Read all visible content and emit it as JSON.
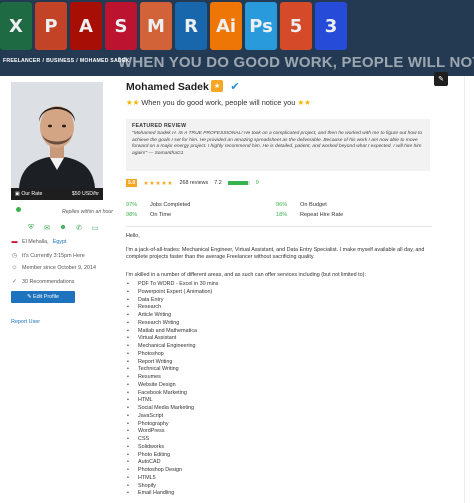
{
  "banner": {
    "icons": [
      {
        "name": "excel-icon",
        "glyph": "X",
        "color": "#1d6f42"
      },
      {
        "name": "powerpoint-icon",
        "glyph": "P",
        "color": "#d04423"
      },
      {
        "name": "acrobat-icon",
        "glyph": "A",
        "color": "#b30b00"
      },
      {
        "name": "solidworks-icon",
        "glyph": "S",
        "color": "#c8102e"
      },
      {
        "name": "matlab-icon",
        "glyph": "M",
        "color": "#e16737"
      },
      {
        "name": "revit-icon",
        "glyph": "R",
        "color": "#186bb4"
      },
      {
        "name": "illustrator-icon",
        "glyph": "Ai",
        "color": "#ff7c00"
      },
      {
        "name": "photoshop-icon",
        "glyph": "Ps",
        "color": "#2aa3e8"
      },
      {
        "name": "html5-icon",
        "glyph": "5",
        "color": "#e44d26"
      },
      {
        "name": "css3-icon",
        "glyph": "3",
        "color": "#264de4"
      }
    ],
    "slogan": "WHEN YOU DO GOOD WORK, PEOPLE WILL NOTICE YOU",
    "breadcrumbs": [
      "FREELANCER",
      "/",
      "BUSINESS",
      "/",
      "MOHAMED SADEK"
    ]
  },
  "profile": {
    "rate_label": "Our Rate",
    "rate_value": "$50 USD/hr",
    "replies": "Replies within an hour",
    "location_prefix": "El Mehalla,",
    "location_country": "Egypt",
    "local_time": "It's Currently 3:15pm Here",
    "member_since": "Member since October 9, 2014",
    "recommendations": "30 Recommendations",
    "edit_profile": "Edit Profile",
    "report_user": "Report User"
  },
  "main": {
    "name": "Mohamed Sadek",
    "tagline": "When you do good work, people will notice you",
    "review_title": "FEATURED REVIEW",
    "review_text": "\"Mohamed Sadek H. IS A TRUE PROFESSIONAL! He took on a complicated project, and then he worked with me to figure out how to achieve the goals I set for him. He provided an amazing spreadsheet as the deliverable. Because of his work I am now able to move forward on a major energy project. I highly recommend him. He is detailed, patient, and worked beyond what I expected. I will hire him again!\" — SamanthaG1",
    "rating": "5.0",
    "reviews": "268 reviews",
    "earnings_score": "7.2",
    "earnings_level": 0.9,
    "earnings_suffix": "9",
    "stats": [
      {
        "value": "97%",
        "label": "Jobs Completed"
      },
      {
        "value": "96%",
        "label": "On Budget"
      },
      {
        "value": "98%",
        "label": "On Time"
      },
      {
        "value": "18%",
        "label": "Repeat Hire Rate"
      }
    ],
    "greeting": "Hello,",
    "intro": "I'm a jack-of-all-trades: Mechanical Engineer, Virtual Assistant, and Data Entry Specialist. I make myself available all day, and complete projects faster than the average Freelancer without sacrificing quality.",
    "skills_intro": "I'm skilled in a number of different areas, and as such can offer services including (but not limited to):",
    "skills": [
      "PDF To WORD - Excel in 30 mins",
      "Powerpoint Expert  ( Animation)",
      "Data Entry",
      "Research",
      "Article Writing",
      "Research Writing",
      "Matlab and Mathematica",
      "Virtual Assistant",
      "Mechanical Engineering",
      "Photoshop",
      "Report Writing",
      "Technical Writing",
      "Resumes",
      "Website Design",
      "Facebook Marketing",
      "HTML",
      "Social Media Marketing",
      "JavaScript",
      "Photography",
      "WordPress",
      "CSS",
      "Solidworks",
      "Photo Editing",
      "AutoCAD",
      "Photoshop Design",
      "HTML5",
      "Shopify",
      "Email Handling"
    ]
  },
  "colors": {
    "accent": "#1e73be",
    "success": "#37b24d",
    "star": "#f5a623",
    "banner": "#243a52"
  }
}
